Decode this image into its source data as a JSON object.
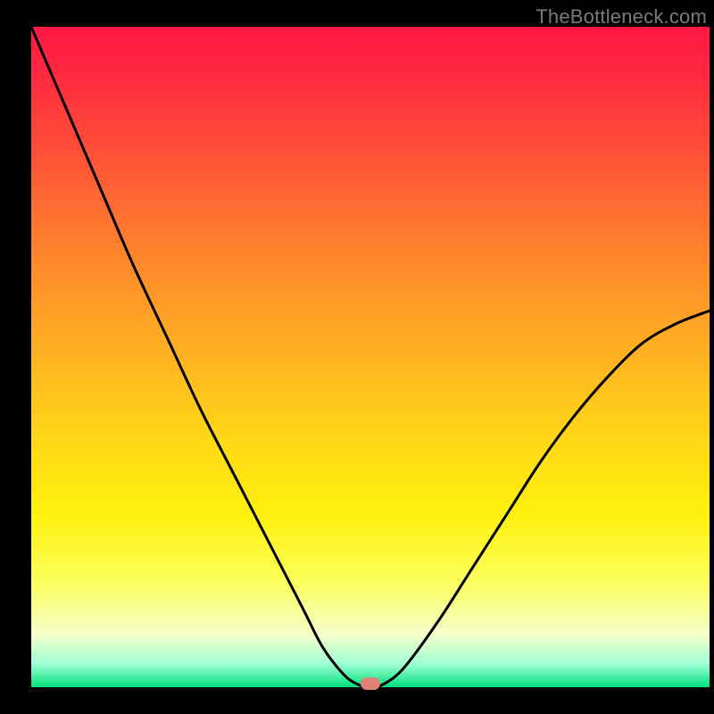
{
  "watermark": "TheBottleneck.com",
  "chart_data": {
    "type": "line",
    "title": "",
    "xlabel": "",
    "ylabel": "",
    "x": [
      0.0,
      0.05,
      0.1,
      0.15,
      0.2,
      0.25,
      0.3,
      0.35,
      0.4,
      0.43,
      0.46,
      0.48,
      0.5,
      0.52,
      0.55,
      0.6,
      0.65,
      0.7,
      0.75,
      0.8,
      0.85,
      0.9,
      0.95,
      1.0
    ],
    "values": [
      1.0,
      0.88,
      0.76,
      0.64,
      0.53,
      0.42,
      0.32,
      0.22,
      0.12,
      0.06,
      0.02,
      0.005,
      0.0,
      0.005,
      0.03,
      0.1,
      0.18,
      0.26,
      0.34,
      0.41,
      0.47,
      0.52,
      0.55,
      0.57
    ],
    "xlim": [
      0,
      1
    ],
    "ylim": [
      0,
      1
    ],
    "marker": {
      "x": 0.5,
      "y": 0.0
    },
    "curve_color": "#000000",
    "curve_width": 3
  }
}
